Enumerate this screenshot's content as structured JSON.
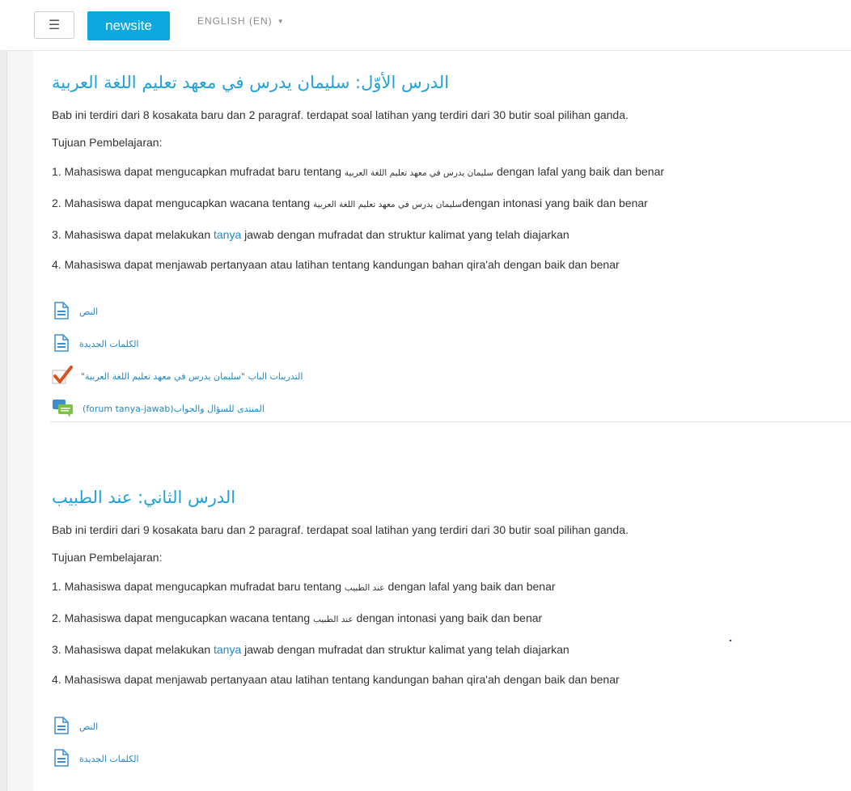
{
  "navbar": {
    "brand": "newsite",
    "language": "ENGLISH (EN)"
  },
  "sections": [
    {
      "title": "الدرس الأوّل: سليمان يدرس في معهد تعليم اللغة العربية",
      "summary": "Bab ini terdiri dari 8 kosakata baru dan 2 paragraf. terdapat soal latihan yang terdiri dari 30 butir soal pilihan ganda.",
      "objectives_heading": "Tujuan Pembelajaran:",
      "obj1": {
        "pre": "1. Mahasiswa dapat mengucapkan mufradat baru tentang ",
        "ar": "سليمان يدرس في معهد تعليم اللغة العربية",
        "post": " dengan lafal yang baik dan benar"
      },
      "obj2": {
        "pre": "2. Mahasiswa dapat mengucapkan wacana tentang ",
        "ar": "سليمان يدرس في معهد تعليم اللغة العربية",
        "post": "dengan intonasi yang baik dan benar"
      },
      "obj3": {
        "pre": "3. Mahasiswa dapat melakukan ",
        "link": "tanya",
        "post": " jawab dengan mufradat dan struktur kalimat yang telah diajarkan"
      },
      "obj4": "4. Mahasiswa dapat menjawab pertanyaan atau latihan tentang kandungan bahan qira'ah dengan baik dan benar",
      "activities": [
        {
          "icon": "file-icon",
          "label": "النص"
        },
        {
          "icon": "file-icon",
          "label": "الكلمات الجديدة"
        },
        {
          "icon": "quiz-check-icon",
          "label": "التدريبات الباب \"سليمان يدرس في معهد تعليم اللغة العربية\""
        },
        {
          "icon": "forum-icon",
          "label": "المنتدى للسؤال والجواب(forum tanya-jawab)"
        }
      ]
    },
    {
      "title": "الدرس الثاني: عند الطبيب",
      "summary": "Bab ini terdiri dari 9 kosakata baru dan 2 paragraf. terdapat soal latihan yang terdiri dari 30 butir soal pilihan ganda.",
      "objectives_heading": "Tujuan Pembelajaran:",
      "obj1": {
        "pre": "1. Mahasiswa dapat mengucapkan mufradat baru tentang ",
        "ar": "عند الطبيب",
        "post": " dengan lafal yang baik dan benar"
      },
      "obj2": {
        "pre": "2. Mahasiswa dapat mengucapkan wacana tentang ",
        "ar": "عند الطبيب",
        "post": " dengan intonasi yang baik dan benar"
      },
      "obj3": {
        "pre": "3. Mahasiswa dapat melakukan ",
        "link": "tanya",
        "post": " jawab dengan mufradat dan struktur kalimat yang telah diajarkan"
      },
      "obj4": "4. Mahasiswa dapat menjawab pertanyaan atau latihan tentang kandungan bahan qira'ah dengan baik dan benar",
      "activities": [
        {
          "icon": "file-icon",
          "label": "النص"
        },
        {
          "icon": "file-icon",
          "label": "الكلمات الجديدة"
        }
      ]
    }
  ],
  "colors": {
    "brand": "#0fa7df",
    "link": "#1e88c8",
    "heading": "#1ea1dc",
    "check": "#d9541e",
    "forum": "#7cc242"
  }
}
